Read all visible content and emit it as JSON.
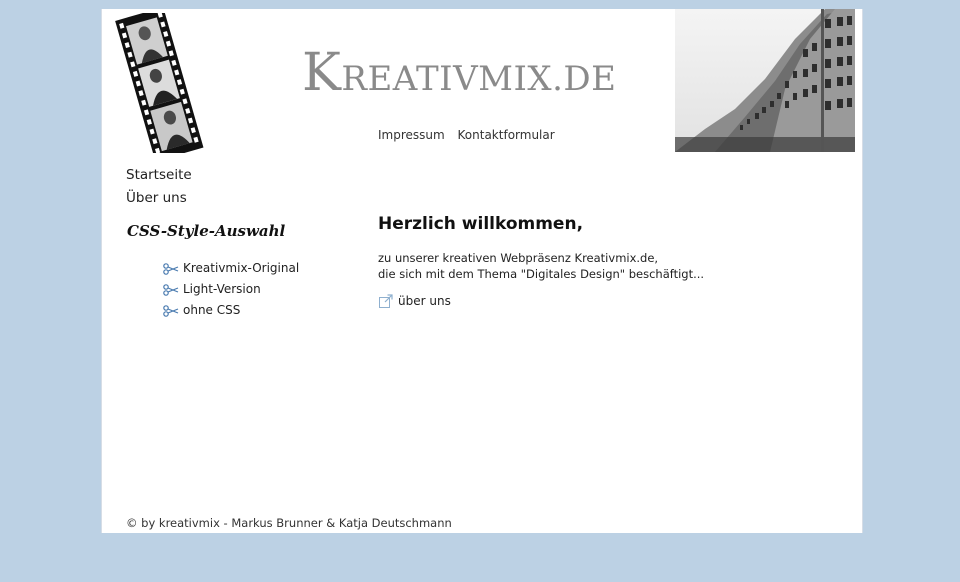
{
  "site": {
    "logo_text_cap": "K",
    "logo_text_rest": "REATIVMIX.DE"
  },
  "top_nav": {
    "items": [
      {
        "label": "Impressum"
      },
      {
        "label": "Kontaktformular"
      }
    ]
  },
  "main_nav": {
    "items": [
      {
        "label": "Startseite"
      },
      {
        "label": "Über uns"
      }
    ]
  },
  "css_selector": {
    "title": "CSS-Style-Auswahl",
    "items": [
      {
        "label": "Kreativmix-Original",
        "icon": "scissors-icon"
      },
      {
        "label": "Light-Version",
        "icon": "scissors-icon"
      },
      {
        "label": "ohne CSS",
        "icon": "scissors-icon"
      }
    ]
  },
  "content": {
    "title": "Herzlich willkommen,",
    "line1": "zu unserer kreativen Webpräsenz Kreativmix.de,",
    "line2": "die sich mit dem Thema \"Digitales Design\" beschäftigt...",
    "link_label": "über uns",
    "link_icon": "external-link-icon"
  },
  "footer": {
    "text": "© by kreativmix - Markus Brunner & Katja Deutschmann"
  },
  "colors": {
    "background": "#bcd1e4",
    "page": "#ffffff",
    "logo": "#8a8a8a"
  }
}
